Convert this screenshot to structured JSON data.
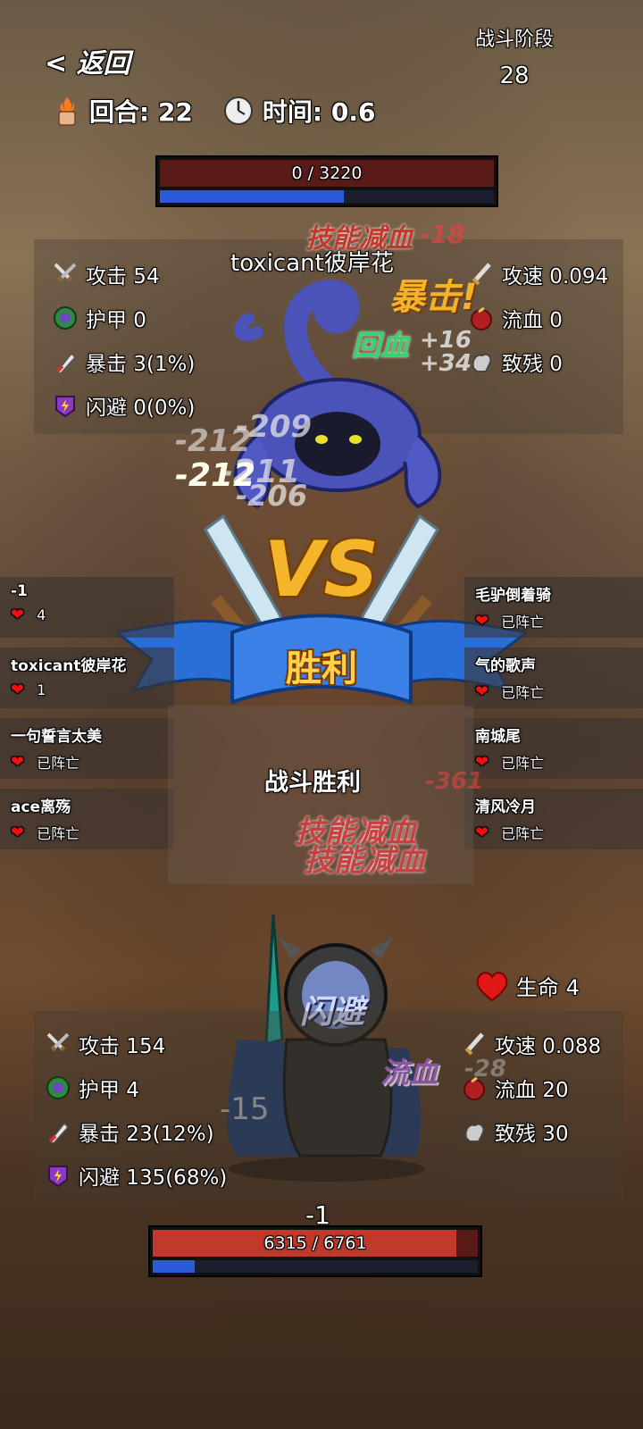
{
  "header": {
    "back_label": "< 返回",
    "round_label": "回合: 22",
    "time_label": "时间: 0.6",
    "stage_label": "战斗阶段",
    "stage_value": "28"
  },
  "enemy": {
    "hp_text": "0 / 3220",
    "hp_fraction": 0,
    "mana_fraction": 0.55,
    "name": "toxicant彼岸花",
    "stats_left": [
      {
        "icon": "sword-icon",
        "label": "攻击 54"
      },
      {
        "icon": "armor-icon",
        "label": "护甲 0"
      },
      {
        "icon": "crit-icon",
        "label": "暴击 3(1%)"
      },
      {
        "icon": "dodge-icon",
        "label": "闪避 0(0%)"
      }
    ],
    "stats_right": [
      {
        "icon": "attack-speed-icon",
        "label": "攻速 0.094"
      },
      {
        "icon": "bleed-icon",
        "label": "流血 0"
      },
      {
        "icon": "cripple-icon",
        "label": "致残 0"
      }
    ]
  },
  "player": {
    "hp_text": "6315 / 6761",
    "hp_fraction": 0.934,
    "mana_fraction": 0.13,
    "life_label": "生命 4",
    "stats_left": [
      {
        "icon": "sword-icon",
        "label": "攻击 154"
      },
      {
        "icon": "armor-icon",
        "label": "护甲 4"
      },
      {
        "icon": "crit-icon",
        "label": "暴击 23(12%)"
      },
      {
        "icon": "dodge-icon",
        "label": "闪避 135(68%)"
      }
    ],
    "stats_right": [
      {
        "icon": "attack-speed-icon",
        "label": "攻速 0.088"
      },
      {
        "icon": "bleed-icon",
        "label": "流血 20"
      },
      {
        "icon": "cripple-icon",
        "label": "致残 30"
      }
    ]
  },
  "left_team": [
    {
      "name": "-1",
      "status": "4"
    },
    {
      "name": "toxicant彼岸花",
      "status": "1"
    },
    {
      "name": "一句誓言太美",
      "status": "已阵亡"
    },
    {
      "name": "ace离殇",
      "status": "已阵亡"
    }
  ],
  "right_team": [
    {
      "name": "毛驴倒着骑",
      "status": "已阵亡"
    },
    {
      "name": "气的歌声",
      "status": "已阵亡"
    },
    {
      "name": "南城尾",
      "status": "已阵亡"
    },
    {
      "name": "清风冷月",
      "status": "已阵亡"
    }
  ],
  "center": {
    "vs_text": "VS",
    "result_banner": "胜利",
    "result_text": "战斗胜利"
  },
  "combat_text": {
    "skill_drain": "技能减血",
    "crit": "暴击!",
    "heal": "回血",
    "dodge": "闪避",
    "bleed": "流血",
    "n1": "-18",
    "n2": "+16",
    "n3": "+34",
    "n4": "-209",
    "n5": "-212",
    "n6": "-211",
    "n7": "-212",
    "n8": "-206",
    "n9": "-361",
    "n10": "-15",
    "n11": "-1",
    "n12": "-28"
  },
  "colors": {
    "hp_red": "#c0392b",
    "mana_blue": "#2a5ad8",
    "banner_blue": "#2a6fd6",
    "gold": "#f5b52a"
  }
}
